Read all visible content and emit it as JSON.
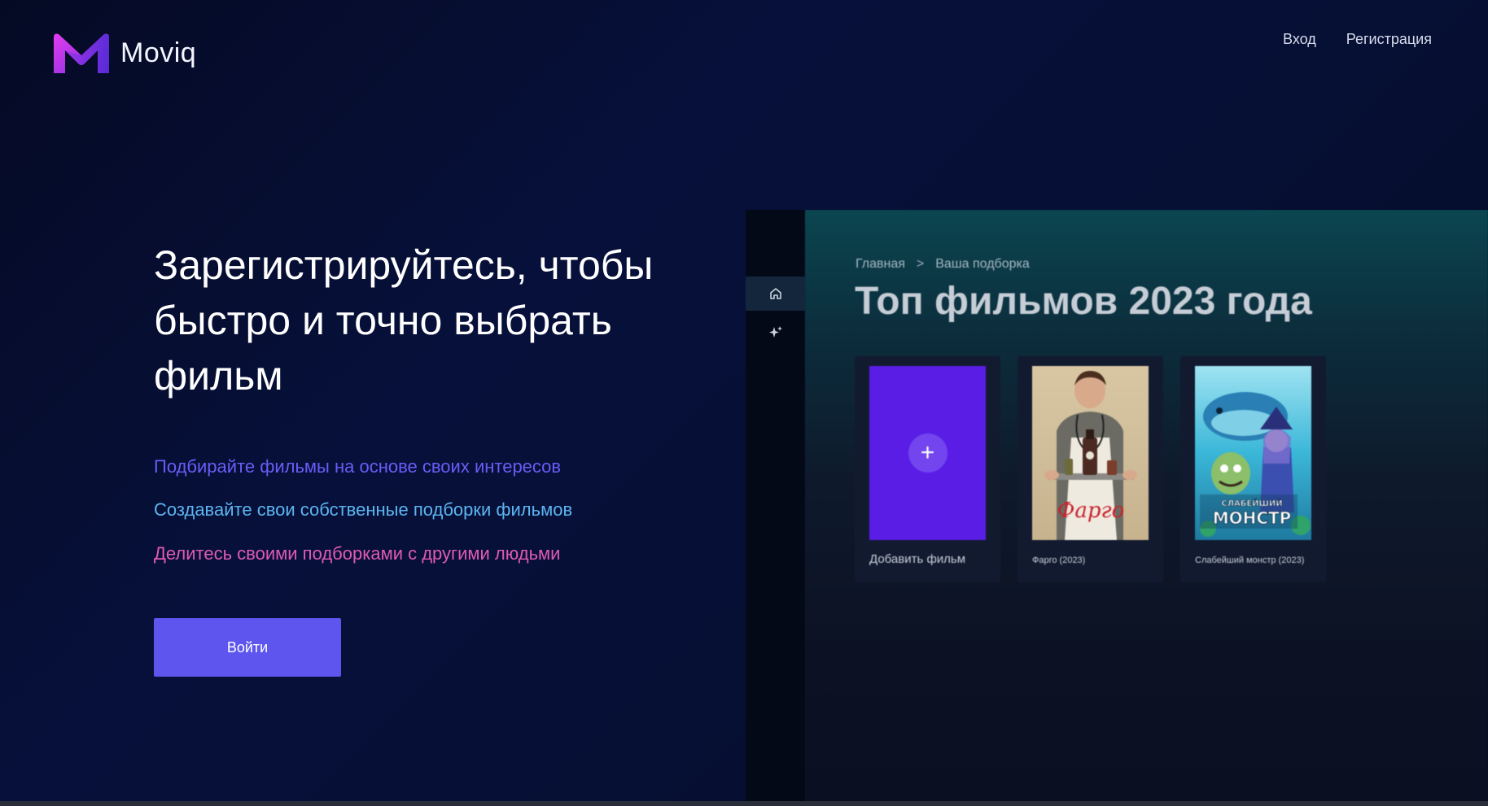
{
  "brand": {
    "name": "Moviq",
    "logo_gradient": [
      "#e33df0",
      "#5b2bd8"
    ]
  },
  "nav": {
    "login": "Вход",
    "register": "Регистрация"
  },
  "hero": {
    "title": "Зарегистрируйтесь, чтобы быстро и точно выбрать фильм",
    "features": [
      {
        "text": "Подбирайте фильмы на основе своих интересов",
        "color": "#6a5cf7"
      },
      {
        "text": "Создавайте свои собственные подборки фильмов",
        "color": "#5cb5f0"
      },
      {
        "text": "Делитесь своими подборками с другими людьми",
        "color": "#e05ab4"
      }
    ],
    "cta": "Войти",
    "cta_color": "#5e55ee"
  },
  "preview": {
    "sidebar": [
      {
        "icon": "home-icon",
        "active": true
      },
      {
        "icon": "sparkle-icon",
        "active": false
      }
    ],
    "breadcrumb": {
      "home": "Главная",
      "separator": ">",
      "current": "Ваша подборка"
    },
    "title": "Топ фильмов 2023 года",
    "cards": [
      {
        "title": "Добавить фильм",
        "type": "add",
        "icon": "plus-icon"
      },
      {
        "title": "Фарго (2023)",
        "type": "movie",
        "poster_text": "Фарго"
      },
      {
        "title": "Слабейший монстр (2023)",
        "type": "movie",
        "poster_text": "СЛАБЕЙШИЙ МОНСТР"
      }
    ]
  }
}
